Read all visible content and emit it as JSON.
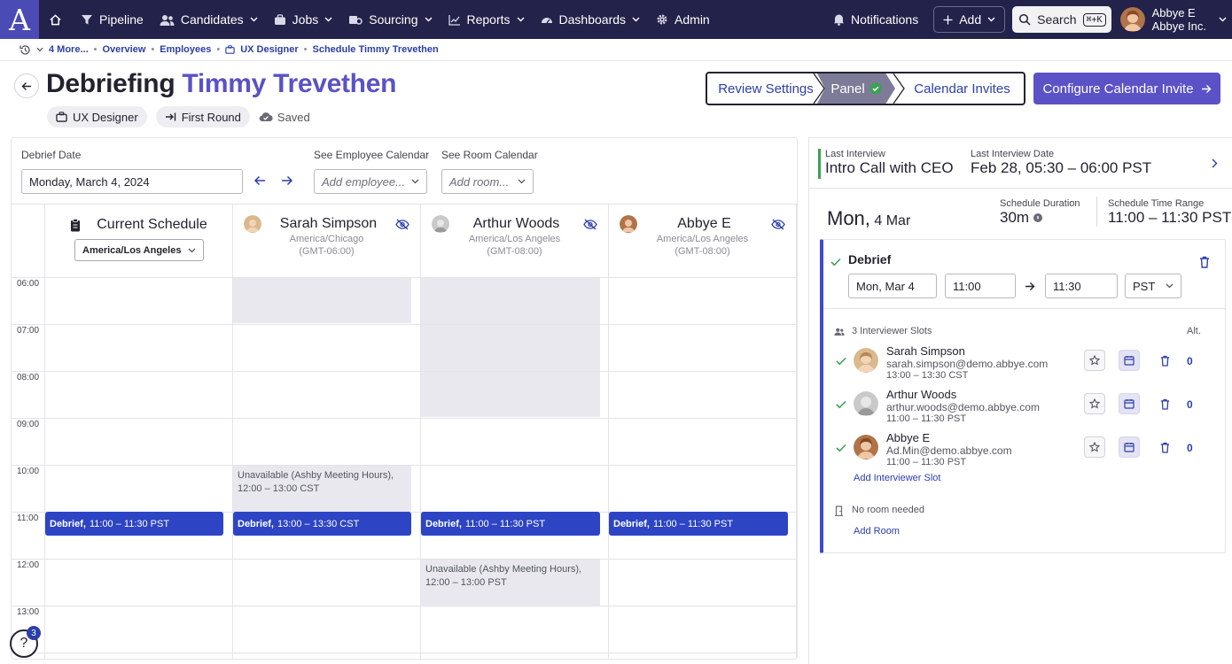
{
  "nav": {
    "logo": "A",
    "items": [
      {
        "label": "Pipeline"
      },
      {
        "label": "Candidates"
      },
      {
        "label": "Jobs"
      },
      {
        "label": "Sourcing"
      },
      {
        "label": "Reports"
      },
      {
        "label": "Dashboards"
      },
      {
        "label": "Admin"
      }
    ],
    "notifications": "Notifications",
    "add": "Add",
    "search": "Search",
    "search_shortcut": "⌘+K",
    "user_name": "Abbye E",
    "user_org": "Abbye Inc."
  },
  "breadcrumb": {
    "more": "4 More...",
    "items": [
      "Overview",
      "Employees",
      "UX Designer",
      "Schedule Timmy Trevethen"
    ]
  },
  "header": {
    "title_prefix": "Debriefing",
    "title_name": "Timmy Trevethen",
    "tag_job": "UX Designer",
    "tag_stage": "First Round",
    "saved": "Saved",
    "steps": [
      "Review Settings",
      "Panel",
      "Calendar Invites"
    ],
    "configure_button": "Configure Calendar Invite"
  },
  "calendar": {
    "debrief_date_label": "Debrief Date",
    "debrief_date_value": "Monday, March 4, 2024",
    "employee_cal_label": "See Employee Calendar",
    "employee_cal_placeholder": "Add employee...",
    "room_cal_label": "See Room Calendar",
    "room_cal_placeholder": "Add room...",
    "current_schedule": "Current Schedule",
    "current_tz": "America/Los Angeles",
    "times": [
      "06:00",
      "07:00",
      "08:00",
      "09:00",
      "10:00",
      "11:00",
      "12:00",
      "13:00"
    ],
    "columns": [
      {
        "name": "Sarah Simpson",
        "tz": "America/Chicago",
        "offset": "(GMT-06:00)"
      },
      {
        "name": "Arthur Woods",
        "tz": "America/Los Angeles",
        "offset": "(GMT-08:00)"
      },
      {
        "name": "Abbye E",
        "tz": "America/Los Angeles",
        "offset": "(GMT-08:00)"
      }
    ],
    "unavailable_label": "Unavailable (Ashby Meeting Hours),",
    "unavailable_sarah_time": "12:00 – 13:00 CST",
    "unavailable_arthur_time": "12:00 – 13:00 PST",
    "event_title": "Debrief,",
    "event_current": "11:00 – 11:30 PST",
    "event_sarah": "13:00 – 13:30 CST",
    "event_arthur": "11:00 – 11:30 PST",
    "event_abbye": "11:00 – 11:30 PST"
  },
  "right": {
    "last_interview_label": "Last Interview",
    "last_interview_value": "Intro Call with CEO",
    "last_date_label": "Last Interview Date",
    "last_date_value": "Feb 28, 05:30 – 06:00 PST",
    "day_big": "Mon,",
    "day_small": "4 Mar",
    "duration_label": "Schedule Duration",
    "duration_value": "30m",
    "range_label": "Schedule Time Range",
    "range_value": "11:00 – 11:30 PST",
    "debrief_title": "Debrief",
    "date_field": "Mon, Mar 4",
    "start_field": "11:00",
    "end_field": "11:30",
    "tz_field": "PST",
    "slots_label": "3 Interviewer Slots",
    "alt_label": "Alt.",
    "slots": [
      {
        "name": "Sarah Simpson",
        "email": "sarah.simpson@demo.abbye.com",
        "time": "13:00 – 13:30 CST",
        "alt": "0"
      },
      {
        "name": "Arthur Woods",
        "email": "arthur.woods@demo.abbye.com",
        "time": "11:00 – 11:30 PST",
        "alt": "0"
      },
      {
        "name": "Abbye E",
        "email": "Ad.Min@demo.abbye.com",
        "time": "11:00 – 11:30 PST",
        "alt": "0"
      }
    ],
    "add_slot": "Add Interviewer Slot",
    "no_room": "No room needed",
    "add_room": "Add Room"
  },
  "help": {
    "icon": "?",
    "badge": "3"
  },
  "colors": {
    "nav_bg": "#22224a",
    "accent": "#5a52c6",
    "event": "#2d45c4",
    "link": "#2c3ea8",
    "success": "#3aa255"
  }
}
